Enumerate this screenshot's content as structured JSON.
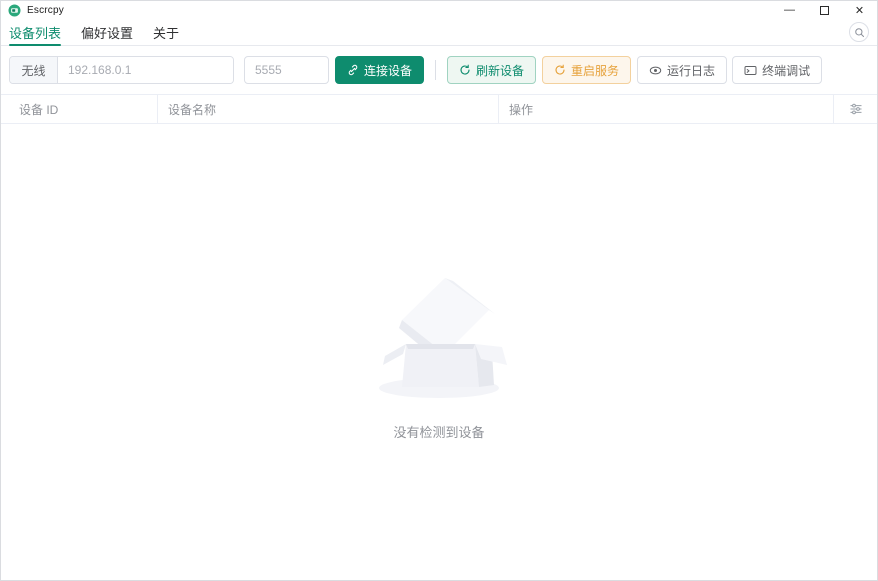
{
  "titlebar": {
    "app_title": "Escrcpy",
    "minimize_glyph": "—",
    "close_glyph": "✕"
  },
  "tabs": {
    "device_list": "设备列表",
    "preferences": "偏好设置",
    "about": "关于"
  },
  "toolbar": {
    "mode_select_value": "无线",
    "ip_placeholder": "192.168.0.1",
    "port_placeholder": "5555",
    "connect_label": "连接设备",
    "refresh_label": "刷新设备",
    "restart_label": "重启服务",
    "logs_label": "运行日志",
    "terminal_label": "终端调试"
  },
  "device_table": {
    "col_device_id": "设备 ID",
    "col_device_name": "设备名称",
    "col_actions": "操作"
  },
  "empty_state": {
    "message": "没有检测到设备"
  },
  "colors": {
    "primary_green": "#0e8c6e",
    "refresh_bg": "#eef7f2",
    "warning_orange": "#e6a23c",
    "warning_bg": "#fdf6ec",
    "placeholder_gray": "#a8abb2",
    "header_text_gray": "#909399",
    "border_gray": "#dcdfe6"
  }
}
